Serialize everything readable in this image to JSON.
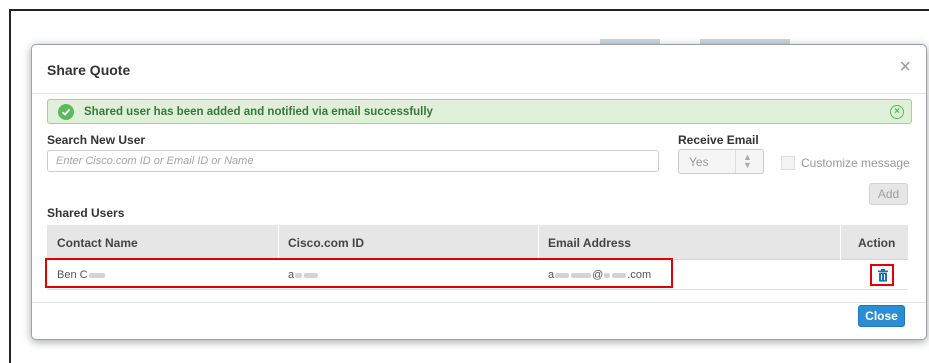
{
  "modal": {
    "title": "Share Quote",
    "close_glyph": "×"
  },
  "alert": {
    "message": "Shared user has been added and notified via email successfully",
    "icon": "check-circle-icon",
    "close_icon": "close-circle-icon",
    "color": "#3c763d"
  },
  "form": {
    "search_label": "Search New User",
    "search_placeholder": "Enter Cisco.com ID or Email ID or Name",
    "search_value": "",
    "receive_email_label": "Receive Email",
    "receive_email_value": "Yes",
    "customize_message_label": "Customize message",
    "customize_message_checked": false,
    "add_label": "Add"
  },
  "shared_users": {
    "section_label": "Shared Users",
    "columns": [
      "Contact Name",
      "Cisco.com ID",
      "Email Address",
      "Action"
    ],
    "rows": [
      {
        "contact_name": "Ben C",
        "cisco_id": "a",
        "email_prefix": "a",
        "email_at": "@",
        "email_suffix": ".com",
        "action_icon": "trash-icon"
      }
    ]
  },
  "footer": {
    "close_label": "Close"
  },
  "colors": {
    "primary_button": "#2b8ed3",
    "alert_border": "#9ed886",
    "alert_bg": "#dff0d8",
    "highlight": "#e00000"
  }
}
